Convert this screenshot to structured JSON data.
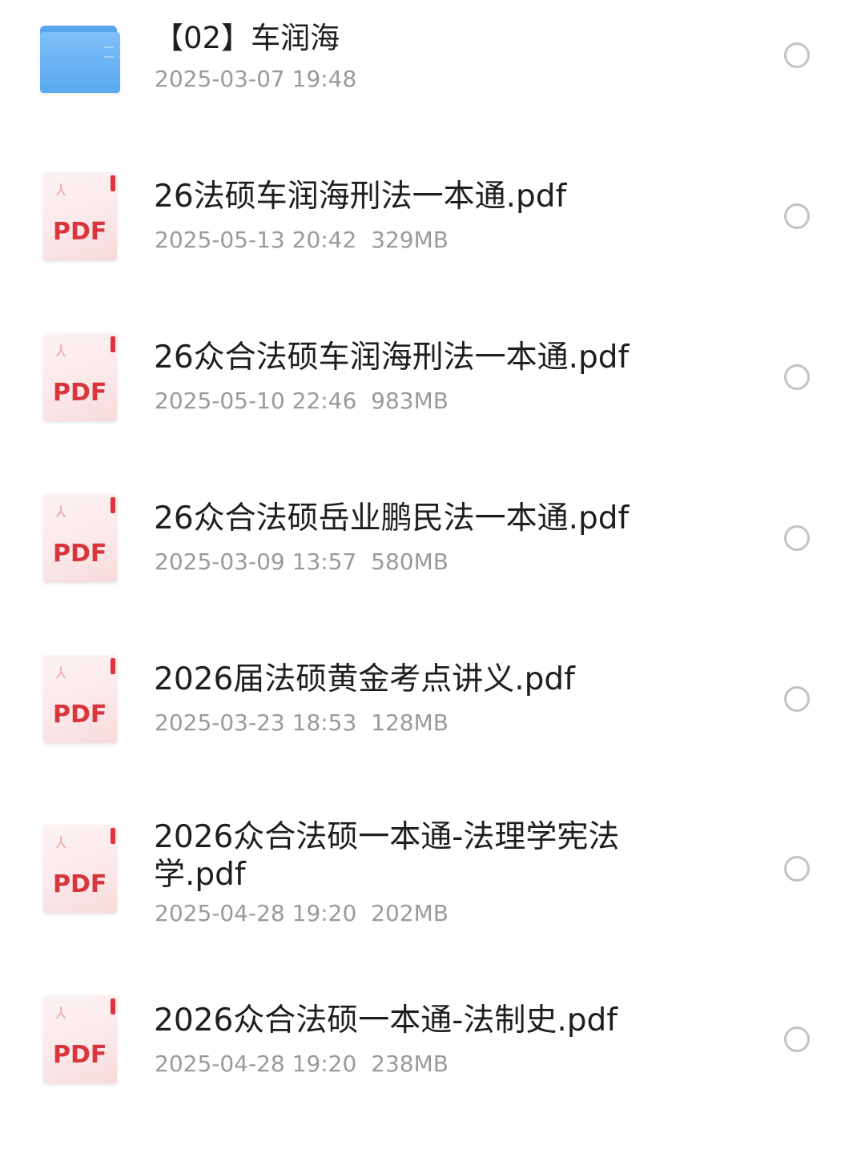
{
  "files": [
    {
      "type": "folder",
      "icon": "folder-icon",
      "name": "【02】车润海",
      "date": "2025-03-07 19:48",
      "size": ""
    },
    {
      "type": "pdf",
      "icon": "pdf-icon",
      "badge": "PDF",
      "name": "26法硕车润海刑法一本通.pdf",
      "date": "2025-05-13 20:42",
      "size": "329MB"
    },
    {
      "type": "pdf",
      "icon": "pdf-icon",
      "badge": "PDF",
      "name": "26众合法硕车润海刑法一本通.pdf",
      "date": "2025-05-10 22:46",
      "size": "983MB"
    },
    {
      "type": "pdf",
      "icon": "pdf-icon",
      "badge": "PDF",
      "name": "26众合法硕岳业鹏民法一本通.pdf",
      "date": "2025-03-09 13:57",
      "size": "580MB"
    },
    {
      "type": "pdf",
      "icon": "pdf-icon",
      "badge": "PDF",
      "name": "2026届法硕黄金考点讲义.pdf",
      "date": "2025-03-23 18:53",
      "size": "128MB"
    },
    {
      "type": "pdf",
      "icon": "pdf-icon",
      "badge": "PDF",
      "name": "2026众合法硕一本通-法理学宪法学.pdf",
      "date": "2025-04-28 19:20",
      "size": "202MB"
    },
    {
      "type": "pdf",
      "icon": "pdf-icon",
      "badge": "PDF",
      "name": "2026众合法硕一本通-法制史.pdf",
      "date": "2025-04-28 19:20",
      "size": "238MB"
    }
  ],
  "colors": {
    "folder": "#5aa8ef",
    "pdf_red": "#d8353d",
    "text": "#1e1e1e",
    "meta_text": "#9a9a9a",
    "radio_border": "#c3c3c3"
  }
}
